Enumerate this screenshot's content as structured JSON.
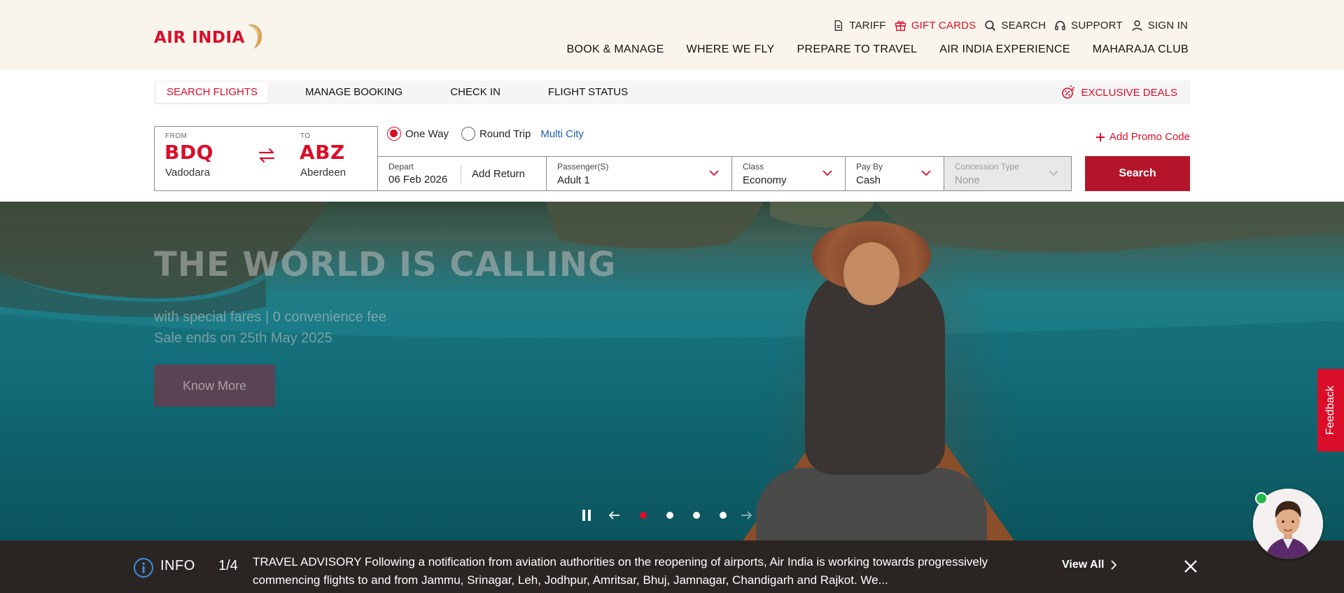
{
  "brand": {
    "name": "AIR INDIA",
    "accent": "#da0e29"
  },
  "utility_nav": [
    {
      "label": "TARIFF",
      "icon": "document-icon"
    },
    {
      "label": "GIFT CARDS",
      "icon": "gift-icon"
    },
    {
      "label": "SEARCH",
      "icon": "search-icon"
    },
    {
      "label": "SUPPORT",
      "icon": "headset-icon"
    },
    {
      "label": "SIGN IN",
      "icon": "user-icon"
    }
  ],
  "main_nav": [
    "BOOK & MANAGE",
    "WHERE WE FLY",
    "PREPARE TO TRAVEL",
    "AIR INDIA EXPERIENCE",
    "MAHARAJA CLUB"
  ],
  "booking_tabs": [
    "SEARCH FLIGHTS",
    "MANAGE BOOKING",
    "CHECK IN",
    "FLIGHT STATUS"
  ],
  "exclusive_deals": "EXCLUSIVE DEALS",
  "search_form": {
    "from": {
      "label": "FROM",
      "code": "BDQ",
      "city": "Vadodara"
    },
    "to": {
      "label": "TO",
      "code": "ABZ",
      "city": "Aberdeen"
    },
    "trip_types": {
      "one_way": "One Way",
      "round_trip": "Round Trip",
      "multi_city": "Multi City",
      "selected": "One Way"
    },
    "promo": "Add Promo Code",
    "depart": {
      "label": "Depart",
      "value": "06 Feb 2026",
      "add_return": "Add Return"
    },
    "passengers": {
      "label": "Passenger(S)",
      "value": "Adult 1"
    },
    "class": {
      "label": "Class",
      "value": "Economy"
    },
    "pay_by": {
      "label": "Pay By",
      "value": "Cash"
    },
    "concession": {
      "label": "Concession Type",
      "value": "None"
    },
    "search_button": "Search"
  },
  "hero": {
    "title": "THE WORLD IS CALLING",
    "subtitle_line1": "with special fares | 0 convenience fee",
    "subtitle_line2": "Sale ends on 25th May 2025",
    "cta": "Know More",
    "slide_count": 4,
    "active_slide": 1
  },
  "feedback": "Feedback",
  "info_bar": {
    "label": "INFO",
    "counter": "1/4",
    "text": "TRAVEL ADVISORY Following a notification from aviation authorities on the reopening of airports, Air India is working towards progressively commencing flights to and from Jammu, Srinagar, Leh, Jodhpur, Amritsar, Bhuj, Jamnagar, Chandigarh and Rajkot. We...",
    "view_all": "View All"
  }
}
